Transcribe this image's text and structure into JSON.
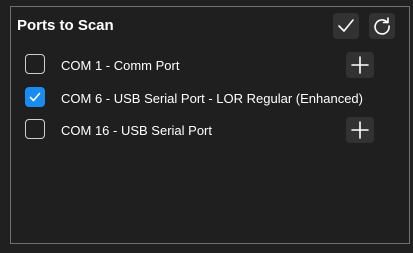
{
  "panel": {
    "title": "Ports to Scan",
    "actions": [
      {
        "icon": "check-icon"
      },
      {
        "icon": "refresh-icon"
      }
    ]
  },
  "ports": [
    {
      "label": "COM 1 - Comm Port",
      "checked": false,
      "has_add": true
    },
    {
      "label": "COM 6 - USB Serial Port - LOR Regular (Enhanced)",
      "checked": true,
      "has_add": false
    },
    {
      "label": "COM 16 - USB Serial Port",
      "checked": false,
      "has_add": true
    }
  ],
  "colors": {
    "accent": "#1a8cf0",
    "background": "#1f1f1f",
    "button": "#323232",
    "border": "#707070"
  }
}
